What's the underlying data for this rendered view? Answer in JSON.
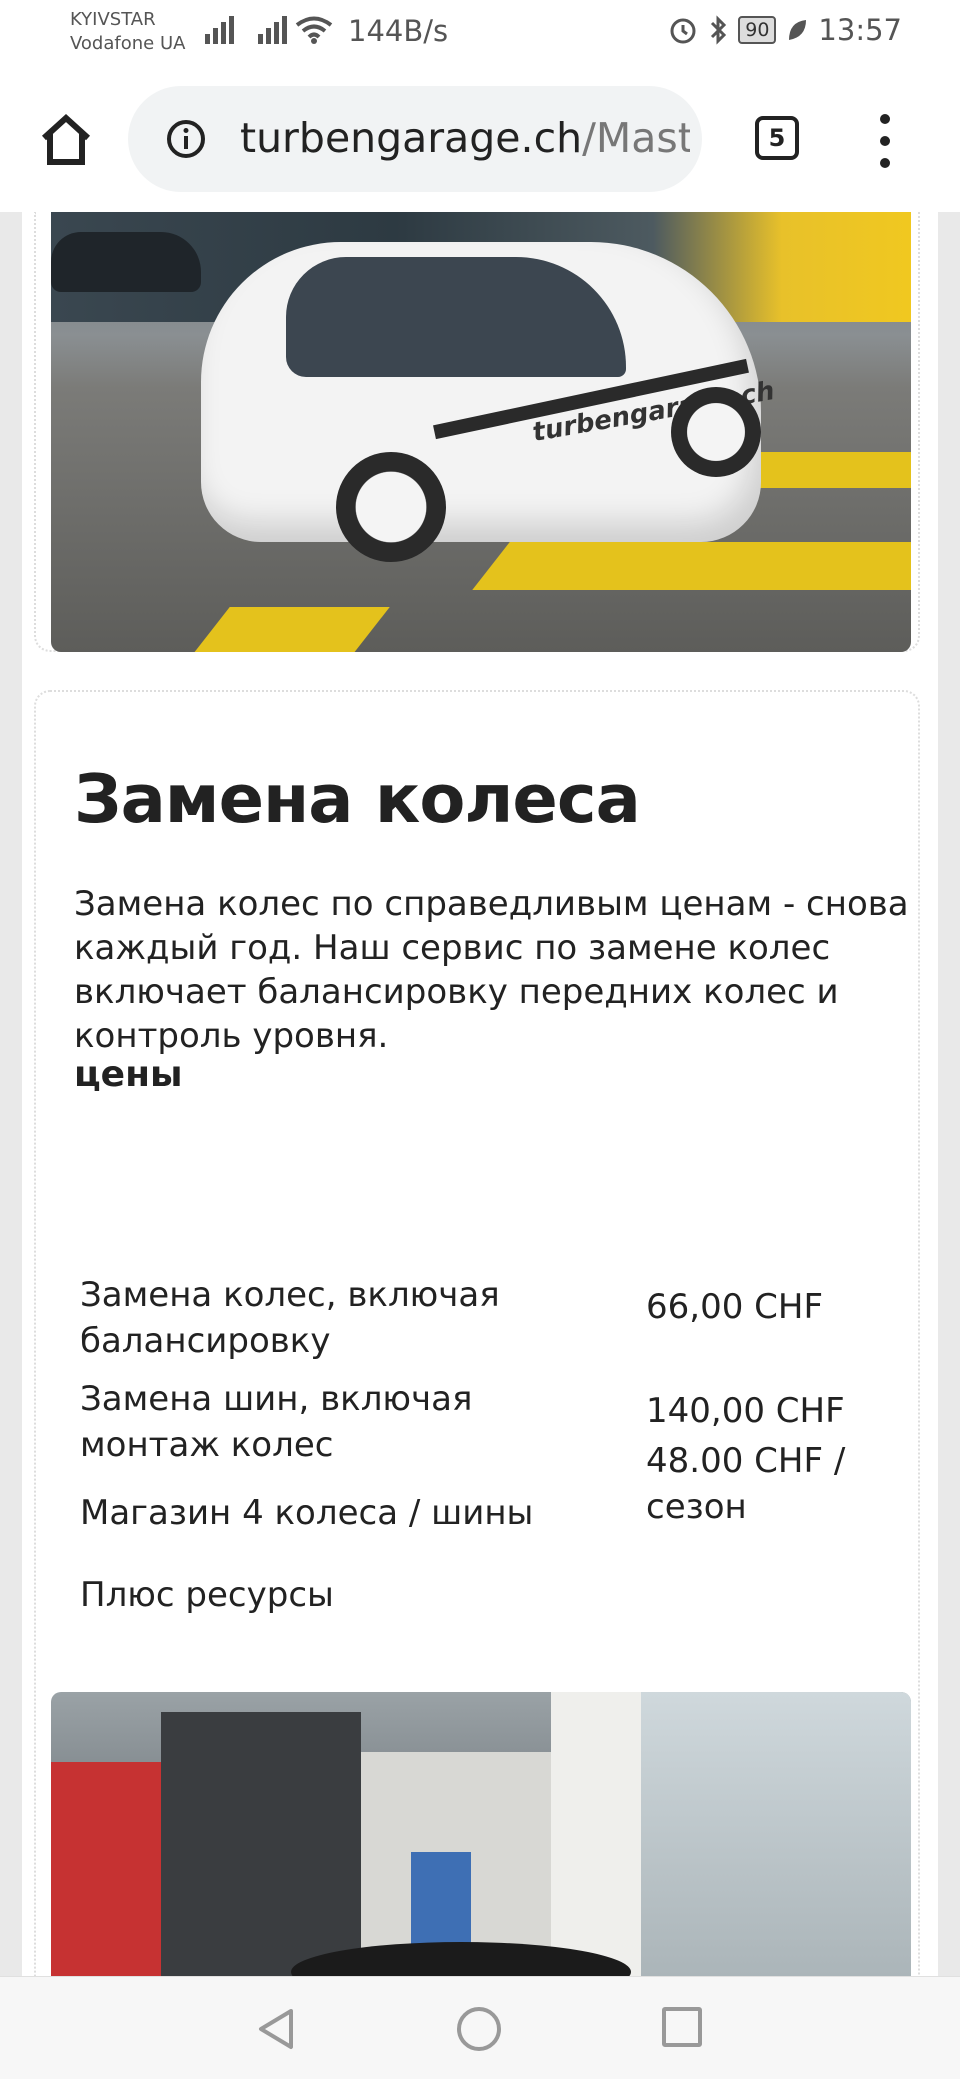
{
  "status_bar": {
    "carrier_1": "KYIVSTAR",
    "carrier_2": "Vodafone UA",
    "net_speed": "144B/s",
    "battery": "90",
    "time": "13:57"
  },
  "browser": {
    "url_host": "turbengarage.ch",
    "url_rest": "/Maste",
    "tab_count": "5"
  },
  "images": {
    "car_logo": "turbengarage.ch"
  },
  "section": {
    "title": "Замена колеса",
    "description": "Замена колес по справедливым ценам - снова каждый год. Наш сервис по замене колес включает балансировку передних колес и контроль уровня.",
    "prices_heading": "цены",
    "price_rows": [
      {
        "name": "Замена колес, включая балансировку",
        "value": "66,00 CHF"
      },
      {
        "name": "Замена шин, включая монтаж колес",
        "value": "140,00 CHF"
      },
      {
        "name": "Магазин 4 колеса / шины",
        "value": "48.00 CHF / сезон"
      },
      {
        "name": "Плюс ресурсы",
        "value": ""
      }
    ]
  },
  "colors": {
    "stripe_yellow": "#e4c21c",
    "text": "#222222",
    "url_gray": "#777777"
  }
}
